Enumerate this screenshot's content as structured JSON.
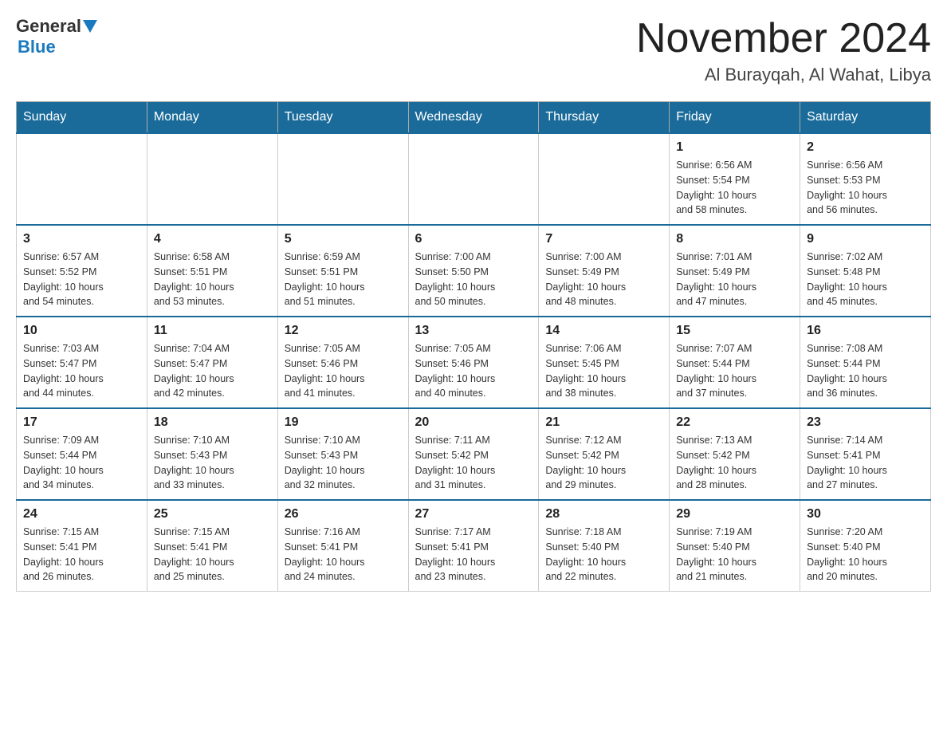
{
  "header": {
    "logo_general": "General",
    "logo_blue": "Blue",
    "month_title": "November 2024",
    "location": "Al Burayqah, Al Wahat, Libya"
  },
  "weekdays": [
    "Sunday",
    "Monday",
    "Tuesday",
    "Wednesday",
    "Thursday",
    "Friday",
    "Saturday"
  ],
  "weeks": [
    [
      {
        "day": "",
        "info": ""
      },
      {
        "day": "",
        "info": ""
      },
      {
        "day": "",
        "info": ""
      },
      {
        "day": "",
        "info": ""
      },
      {
        "day": "",
        "info": ""
      },
      {
        "day": "1",
        "info": "Sunrise: 6:56 AM\nSunset: 5:54 PM\nDaylight: 10 hours\nand 58 minutes."
      },
      {
        "day": "2",
        "info": "Sunrise: 6:56 AM\nSunset: 5:53 PM\nDaylight: 10 hours\nand 56 minutes."
      }
    ],
    [
      {
        "day": "3",
        "info": "Sunrise: 6:57 AM\nSunset: 5:52 PM\nDaylight: 10 hours\nand 54 minutes."
      },
      {
        "day": "4",
        "info": "Sunrise: 6:58 AM\nSunset: 5:51 PM\nDaylight: 10 hours\nand 53 minutes."
      },
      {
        "day": "5",
        "info": "Sunrise: 6:59 AM\nSunset: 5:51 PM\nDaylight: 10 hours\nand 51 minutes."
      },
      {
        "day": "6",
        "info": "Sunrise: 7:00 AM\nSunset: 5:50 PM\nDaylight: 10 hours\nand 50 minutes."
      },
      {
        "day": "7",
        "info": "Sunrise: 7:00 AM\nSunset: 5:49 PM\nDaylight: 10 hours\nand 48 minutes."
      },
      {
        "day": "8",
        "info": "Sunrise: 7:01 AM\nSunset: 5:49 PM\nDaylight: 10 hours\nand 47 minutes."
      },
      {
        "day": "9",
        "info": "Sunrise: 7:02 AM\nSunset: 5:48 PM\nDaylight: 10 hours\nand 45 minutes."
      }
    ],
    [
      {
        "day": "10",
        "info": "Sunrise: 7:03 AM\nSunset: 5:47 PM\nDaylight: 10 hours\nand 44 minutes."
      },
      {
        "day": "11",
        "info": "Sunrise: 7:04 AM\nSunset: 5:47 PM\nDaylight: 10 hours\nand 42 minutes."
      },
      {
        "day": "12",
        "info": "Sunrise: 7:05 AM\nSunset: 5:46 PM\nDaylight: 10 hours\nand 41 minutes."
      },
      {
        "day": "13",
        "info": "Sunrise: 7:05 AM\nSunset: 5:46 PM\nDaylight: 10 hours\nand 40 minutes."
      },
      {
        "day": "14",
        "info": "Sunrise: 7:06 AM\nSunset: 5:45 PM\nDaylight: 10 hours\nand 38 minutes."
      },
      {
        "day": "15",
        "info": "Sunrise: 7:07 AM\nSunset: 5:44 PM\nDaylight: 10 hours\nand 37 minutes."
      },
      {
        "day": "16",
        "info": "Sunrise: 7:08 AM\nSunset: 5:44 PM\nDaylight: 10 hours\nand 36 minutes."
      }
    ],
    [
      {
        "day": "17",
        "info": "Sunrise: 7:09 AM\nSunset: 5:44 PM\nDaylight: 10 hours\nand 34 minutes."
      },
      {
        "day": "18",
        "info": "Sunrise: 7:10 AM\nSunset: 5:43 PM\nDaylight: 10 hours\nand 33 minutes."
      },
      {
        "day": "19",
        "info": "Sunrise: 7:10 AM\nSunset: 5:43 PM\nDaylight: 10 hours\nand 32 minutes."
      },
      {
        "day": "20",
        "info": "Sunrise: 7:11 AM\nSunset: 5:42 PM\nDaylight: 10 hours\nand 31 minutes."
      },
      {
        "day": "21",
        "info": "Sunrise: 7:12 AM\nSunset: 5:42 PM\nDaylight: 10 hours\nand 29 minutes."
      },
      {
        "day": "22",
        "info": "Sunrise: 7:13 AM\nSunset: 5:42 PM\nDaylight: 10 hours\nand 28 minutes."
      },
      {
        "day": "23",
        "info": "Sunrise: 7:14 AM\nSunset: 5:41 PM\nDaylight: 10 hours\nand 27 minutes."
      }
    ],
    [
      {
        "day": "24",
        "info": "Sunrise: 7:15 AM\nSunset: 5:41 PM\nDaylight: 10 hours\nand 26 minutes."
      },
      {
        "day": "25",
        "info": "Sunrise: 7:15 AM\nSunset: 5:41 PM\nDaylight: 10 hours\nand 25 minutes."
      },
      {
        "day": "26",
        "info": "Sunrise: 7:16 AM\nSunset: 5:41 PM\nDaylight: 10 hours\nand 24 minutes."
      },
      {
        "day": "27",
        "info": "Sunrise: 7:17 AM\nSunset: 5:41 PM\nDaylight: 10 hours\nand 23 minutes."
      },
      {
        "day": "28",
        "info": "Sunrise: 7:18 AM\nSunset: 5:40 PM\nDaylight: 10 hours\nand 22 minutes."
      },
      {
        "day": "29",
        "info": "Sunrise: 7:19 AM\nSunset: 5:40 PM\nDaylight: 10 hours\nand 21 minutes."
      },
      {
        "day": "30",
        "info": "Sunrise: 7:20 AM\nSunset: 5:40 PM\nDaylight: 10 hours\nand 20 minutes."
      }
    ]
  ]
}
